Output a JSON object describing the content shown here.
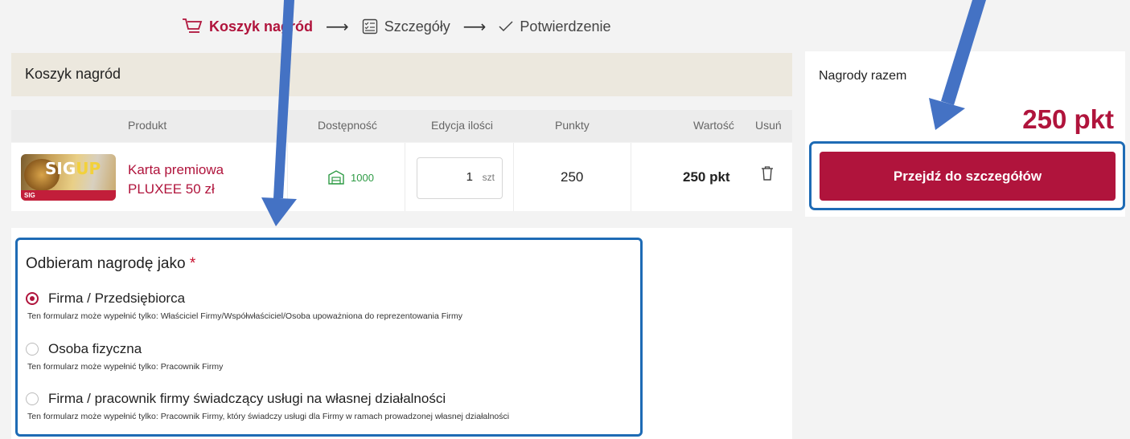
{
  "steps": [
    {
      "label": "Koszyk nagród",
      "icon": "cart-icon",
      "active": true
    },
    {
      "label": "Szczegóły",
      "icon": "checklist-icon",
      "active": false
    },
    {
      "label": "Potwierdzenie",
      "icon": "check-icon",
      "active": false
    }
  ],
  "cart": {
    "title": "Koszyk nagród",
    "columns": {
      "product": "Produkt",
      "availability": "Dostępność",
      "quantity": "Edycja ilości",
      "points": "Punkty",
      "value": "Wartość",
      "remove": "Usuń"
    },
    "item": {
      "name": "Karta premiowa PLUXEE 50 zł",
      "card_brand_1": "SIG",
      "card_brand_2": "UP",
      "card_sig": "SIG",
      "availability": "1000",
      "quantity": "1",
      "unit": "szt",
      "points": "250",
      "value": "250 pkt"
    }
  },
  "form": {
    "title": "Odbieram nagrodę jako",
    "required_mark": "*",
    "options": [
      {
        "label": "Firma / Przedsiębiorca",
        "hint": "Ten formularz może wypełnić tylko: Właściciel Firmy/Współwłaściciel/Osoba upoważniona do reprezentowania Firmy",
        "selected": true
      },
      {
        "label": "Osoba fizyczna",
        "hint": "Ten formularz może wypełnić tylko: Pracownik Firmy",
        "selected": false
      },
      {
        "label": "Firma / pracownik firmy świadczący usługi na własnej działalności",
        "hint": "Ten formularz może wypełnić tylko: Pracownik Firmy, który świadczy usługi dla Firmy w ramach prowadzonej własnej działalności",
        "selected": false
      }
    ]
  },
  "summary": {
    "label": "Nagrody razem",
    "total": "250 pkt",
    "button": "Przejdź do szczegółów"
  },
  "colors": {
    "brand": "#b0143c",
    "highlight": "#1e6bb5",
    "arrow": "#4472c4",
    "availability": "#2e9b45"
  }
}
